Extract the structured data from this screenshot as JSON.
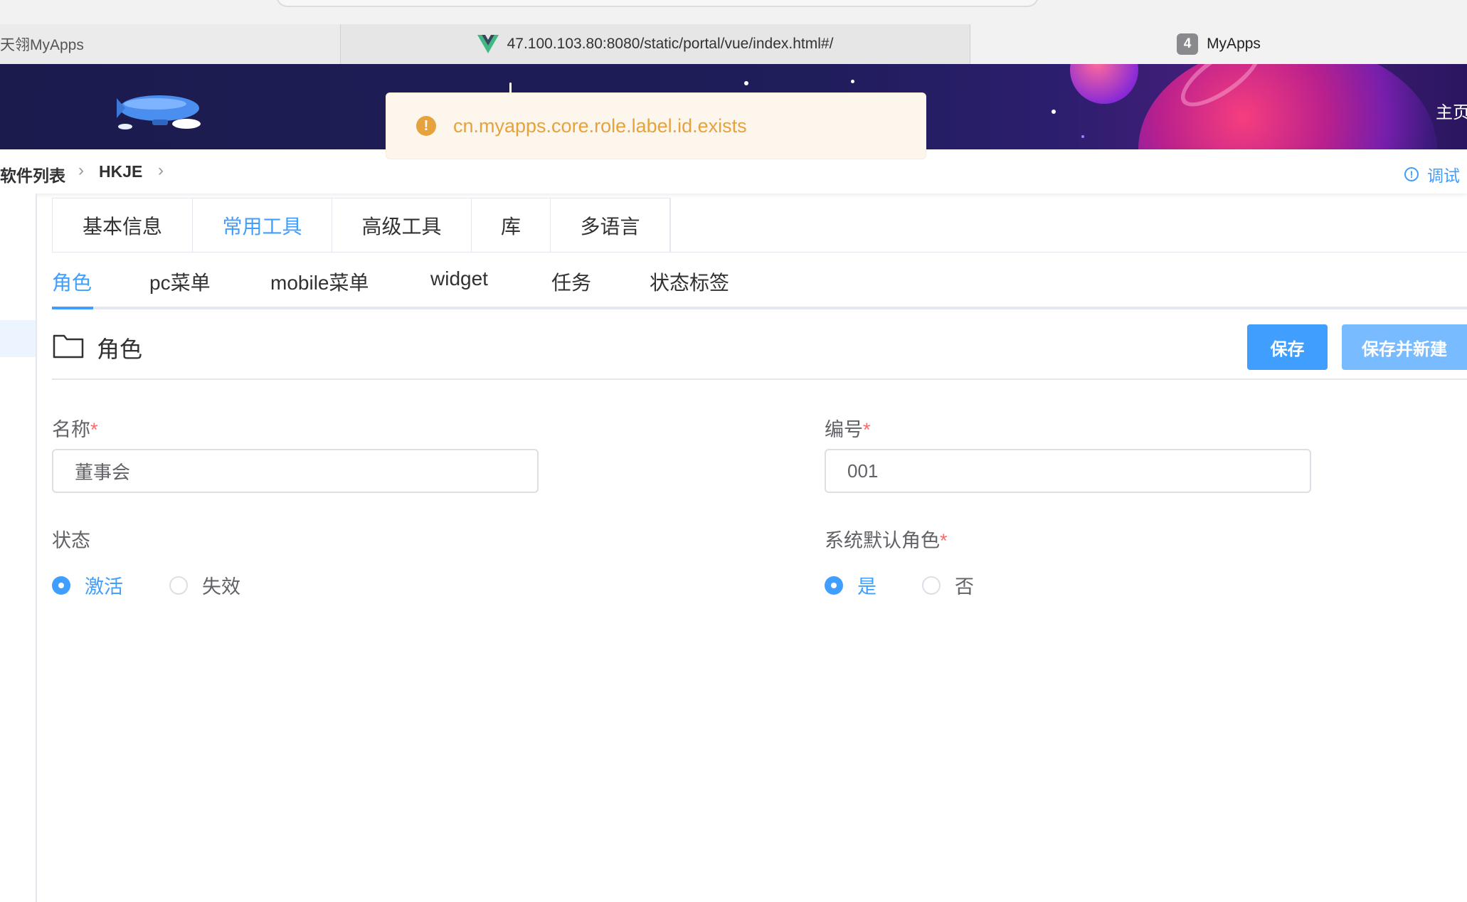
{
  "browser": {
    "tabs": [
      {
        "label": "天翎MyApps"
      },
      {
        "label": "47.100.103.80:8080/static/portal/vue/index.html#/"
      },
      {
        "label": "MyApps",
        "badge": "4"
      }
    ]
  },
  "header": {
    "home_label": "主页"
  },
  "toast": {
    "message": "cn.myapps.core.role.label.id.exists",
    "type": "warning",
    "color": "#e6a23c"
  },
  "breadcrumb": {
    "items": [
      "软件列表",
      "HKJE"
    ],
    "debug_label": "调试"
  },
  "main_tabs": [
    {
      "label": "基本信息",
      "active": false
    },
    {
      "label": "常用工具",
      "active": true
    },
    {
      "label": "高级工具",
      "active": false
    },
    {
      "label": "库",
      "active": false
    },
    {
      "label": "多语言",
      "active": false
    }
  ],
  "sub_tabs": [
    {
      "label": "角色",
      "active": true
    },
    {
      "label": "pc菜单",
      "active": false
    },
    {
      "label": "mobile菜单",
      "active": false
    },
    {
      "label": "widget",
      "active": false
    },
    {
      "label": "任务",
      "active": false
    },
    {
      "label": "状态标签",
      "active": false
    }
  ],
  "section": {
    "title": "角色",
    "save_label": "保存",
    "save_new_label": "保存并新建"
  },
  "form": {
    "name": {
      "label": "名称",
      "required_mark": "*",
      "value": "董事会"
    },
    "code": {
      "label": "编号",
      "required_mark": "*",
      "value": "001"
    },
    "status": {
      "label": "状态",
      "options": [
        "激活",
        "失效"
      ],
      "selected": "激活"
    },
    "default_role": {
      "label": "系统默认角色",
      "required_mark": "*",
      "options": [
        "是",
        "否"
      ],
      "selected": "是"
    }
  },
  "colors": {
    "primary": "#409eff",
    "warning": "#e6a23c",
    "danger": "#f56c6c",
    "banner": "#1f1d5a"
  }
}
